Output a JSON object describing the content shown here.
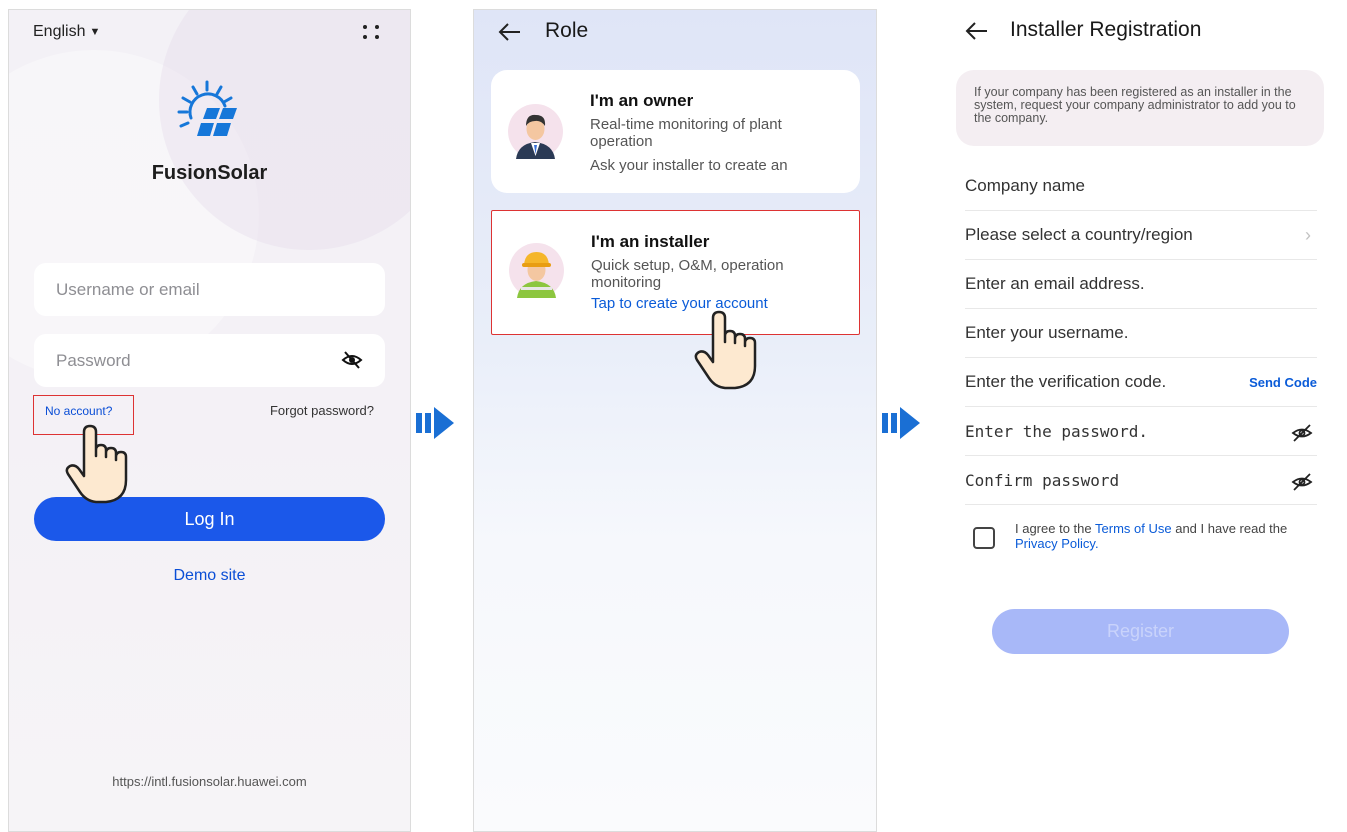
{
  "login": {
    "language": "English",
    "brand": "FusionSolar",
    "username_placeholder": "Username or email",
    "password_placeholder": "Password",
    "no_account": "No account?",
    "forgot_password": "Forgot password?",
    "login_button": "Log In",
    "demo_site": "Demo site",
    "url": "https://intl.fusionsolar.huawei.com"
  },
  "role": {
    "title": "Role",
    "owner": {
      "title": "I'm an owner",
      "description": "Real-time monitoring of plant operation",
      "subtext": "Ask your installer to create an"
    },
    "installer": {
      "title": "I'm an installer",
      "description": "Quick setup, O&M, operation monitoring",
      "link": "Tap to create your account"
    }
  },
  "registration": {
    "title": "Installer Registration",
    "notice": "If your company has been registered as an installer in the system, request your company administrator to add you to the company.",
    "fields": {
      "company_name": "Company name",
      "country": "Please select a country/region",
      "email": "Enter an email address.",
      "username": "Enter your username.",
      "verification": "Enter the verification code.",
      "password": "Enter the password.",
      "confirm_password": "Confirm password"
    },
    "send_code": "Send Code",
    "agree_prefix": "I agree to the",
    "terms_of_use": "Terms of Use",
    "agree_middle": "and I have read the",
    "privacy_policy": "Privacy Policy.",
    "register_button": "Register"
  },
  "icons": {
    "language_caret": "caret-down-icon",
    "more": "more-dots-icon",
    "logo": "fusionsolar-logo",
    "password_visibility": "eye-off-icon",
    "back": "back-arrow-icon",
    "chevron": "chevron-right-icon",
    "pointer": "hand-pointer-icon",
    "flow_arrow": "flow-arrow-icon"
  },
  "colors": {
    "primary": "#1b58ea",
    "link": "#0a5bd8",
    "highlight_box": "#dd3333",
    "disabled_button": "#a8b8f8",
    "flow_arrow": "#1a6fd4"
  }
}
